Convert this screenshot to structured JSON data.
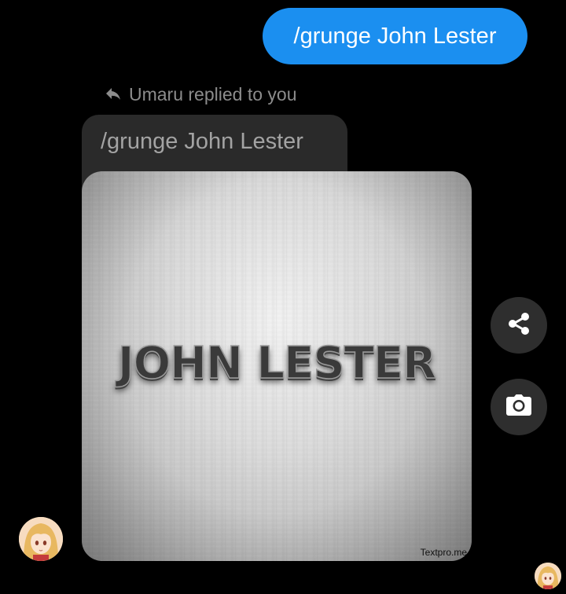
{
  "conversation": {
    "sent_message": {
      "text": "/grunge John Lester"
    },
    "reply": {
      "header": "Umaru replied to you",
      "quoted_text": "/grunge John Lester",
      "image": {
        "overlay_text": "JOHN LESTER",
        "watermark": "Textpro.me"
      }
    },
    "actions": {
      "share_icon": "share-icon",
      "camera_icon": "camera-icon"
    },
    "avatars": {
      "sender": "Umaru avatar",
      "seen_indicator": "seen avatar"
    }
  },
  "colors": {
    "background": "#000000",
    "sent_bubble": "#1b8ff0",
    "received_bubble": "#2a2a2a",
    "action_button": "#2e2e2e",
    "muted_text": "#8c8c8c"
  }
}
